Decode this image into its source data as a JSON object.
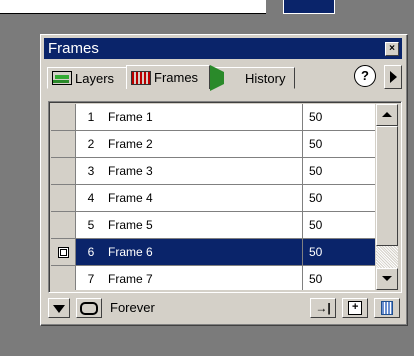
{
  "panel": {
    "title": "Frames"
  },
  "tabs": [
    {
      "label": "Layers",
      "icon": "layers-icon"
    },
    {
      "label": "Frames",
      "icon": "frames-icon",
      "active": true
    },
    {
      "label": "History",
      "icon": "history-icon"
    }
  ],
  "frames": [
    {
      "num": "1",
      "name": "Frame 1",
      "delay": "50"
    },
    {
      "num": "2",
      "name": "Frame 2",
      "delay": "50"
    },
    {
      "num": "3",
      "name": "Frame 3",
      "delay": "50"
    },
    {
      "num": "4",
      "name": "Frame 4",
      "delay": "50"
    },
    {
      "num": "5",
      "name": "Frame 5",
      "delay": "50"
    },
    {
      "num": "6",
      "name": "Frame 6",
      "delay": "50",
      "selected": true
    },
    {
      "num": "7",
      "name": "Frame 7",
      "delay": "50"
    }
  ],
  "footer": {
    "loop_label": "Forever"
  },
  "glyphs": {
    "close": "×",
    "help": "?",
    "onion": "◇",
    "trash": "🗑"
  },
  "colors": {
    "selection": "#0a246a",
    "panel": "#d4d0c8"
  }
}
